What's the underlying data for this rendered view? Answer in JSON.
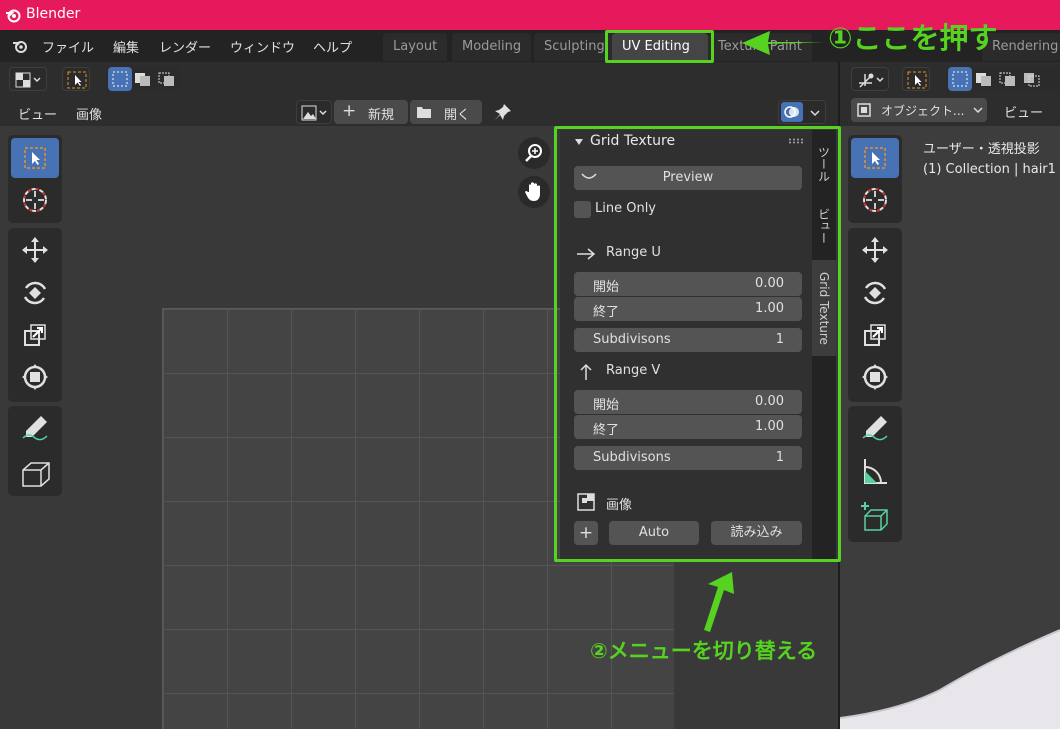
{
  "app": {
    "title": "Blender"
  },
  "menu": {
    "file": "ファイル",
    "edit": "編集",
    "render": "レンダー",
    "window": "ウィンドウ",
    "help": "ヘルプ"
  },
  "workspaces": [
    "Layout",
    "Modeling",
    "Sculpting",
    "UV Editing",
    "Texture Paint",
    "Rendering"
  ],
  "active_workspace": "UV Editing",
  "uv_header": {
    "view": "ビュー",
    "image": "画像",
    "new": "新規",
    "open": "開く"
  },
  "npanel": {
    "title": "Grid Texture",
    "preview": "Preview",
    "line_only": "Line Only",
    "range_u": "Range U",
    "range_v": "Range V",
    "start_label": "開始",
    "end_label": "終了",
    "u_start": "0.00",
    "u_end": "1.00",
    "subdiv_label": "Subdivisons",
    "u_subdiv": "1",
    "v_start": "0.00",
    "v_end": "1.00",
    "v_subdiv": "1",
    "image_label": "画像",
    "auto": "Auto",
    "load": "読み込み",
    "tabs": [
      "ツール",
      "ビュー",
      "Grid Texture"
    ]
  },
  "viewport": {
    "mode": "オブジェクト...",
    "view": "ビュー",
    "overlay_title": "ユーザー・透視投影",
    "overlay_info": "(1) Collection | hair1"
  },
  "annotations": {
    "step1": "①ここを押す",
    "step2": "②メニューを切り替える"
  },
  "colors": {
    "accent": "#4772b3",
    "annotation": "#56d220",
    "titlebar": "#e6195c"
  }
}
